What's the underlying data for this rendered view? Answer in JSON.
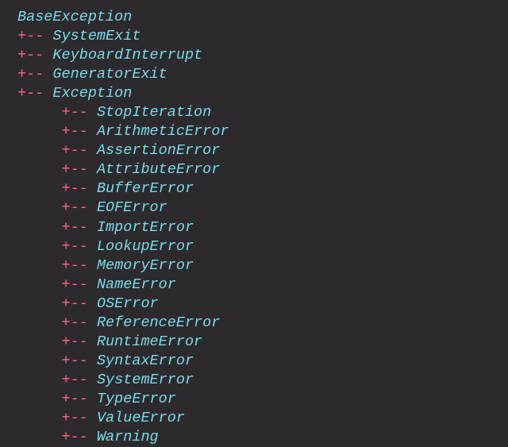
{
  "tree": {
    "root": "BaseException",
    "level1": [
      {
        "connector": "+-- ",
        "name": "SystemExit"
      },
      {
        "connector": "+-- ",
        "name": "KeyboardInterrupt"
      },
      {
        "connector": "+-- ",
        "name": "GeneratorExit"
      },
      {
        "connector": "+-- ",
        "name": "Exception"
      }
    ],
    "level2": [
      {
        "indent": "     ",
        "connector": "+-- ",
        "name": "StopIteration"
      },
      {
        "indent": "     ",
        "connector": "+-- ",
        "name": "ArithmeticError"
      },
      {
        "indent": "     ",
        "connector": "+-- ",
        "name": "AssertionError"
      },
      {
        "indent": "     ",
        "connector": "+-- ",
        "name": "AttributeError"
      },
      {
        "indent": "     ",
        "connector": "+-- ",
        "name": "BufferError"
      },
      {
        "indent": "     ",
        "connector": "+-- ",
        "name": "EOFError"
      },
      {
        "indent": "     ",
        "connector": "+-- ",
        "name": "ImportError"
      },
      {
        "indent": "     ",
        "connector": "+-- ",
        "name": "LookupError"
      },
      {
        "indent": "     ",
        "connector": "+-- ",
        "name": "MemoryError"
      },
      {
        "indent": "     ",
        "connector": "+-- ",
        "name": "NameError"
      },
      {
        "indent": "     ",
        "connector": "+-- ",
        "name": "OSError"
      },
      {
        "indent": "     ",
        "connector": "+-- ",
        "name": "ReferenceError"
      },
      {
        "indent": "     ",
        "connector": "+-- ",
        "name": "RuntimeError"
      },
      {
        "indent": "     ",
        "connector": "+-- ",
        "name": "SyntaxError"
      },
      {
        "indent": "     ",
        "connector": "+-- ",
        "name": "SystemError"
      },
      {
        "indent": "     ",
        "connector": "+-- ",
        "name": "TypeError"
      },
      {
        "indent": "     ",
        "connector": "+-- ",
        "name": "ValueError"
      },
      {
        "indent": "     ",
        "connector": "+-- ",
        "name": "Warning"
      }
    ]
  }
}
